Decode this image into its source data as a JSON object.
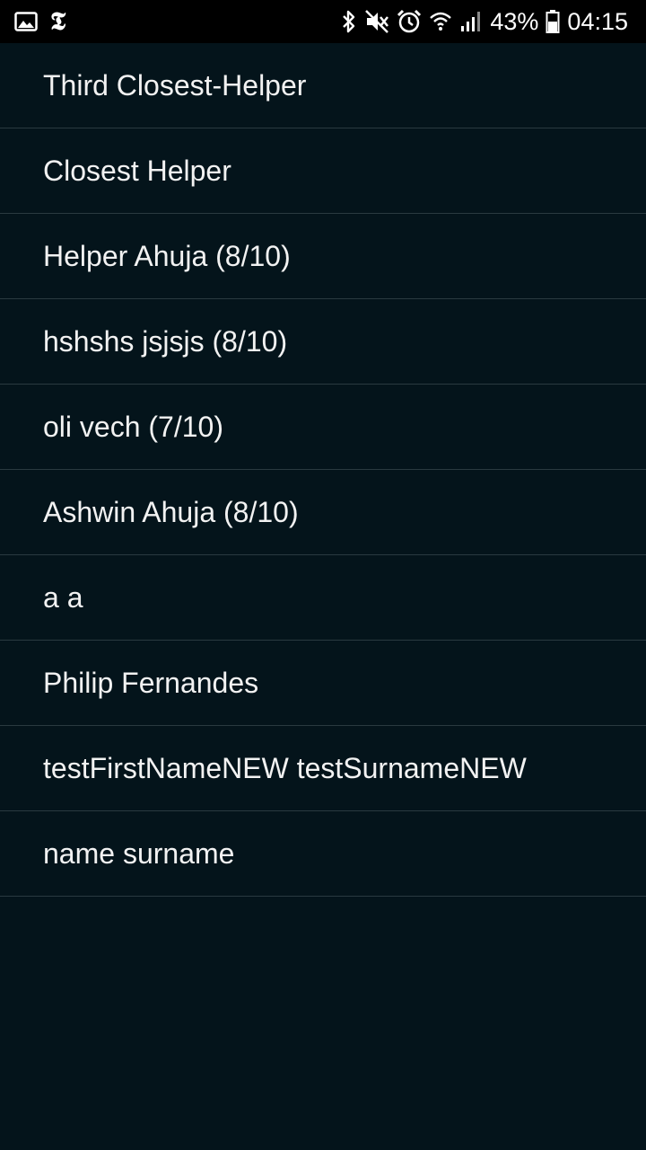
{
  "status_bar": {
    "battery_percent": "43%",
    "time": "04:15",
    "left_icons": [
      "image-icon",
      "nyt-icon"
    ],
    "right_icons": [
      "bluetooth-icon",
      "mute-icon",
      "alarm-icon",
      "wifi-icon",
      "signal-icon",
      "battery-icon"
    ],
    "nyt_glyph": "𝕿"
  },
  "list": {
    "items": [
      {
        "label": "Third Closest-Helper"
      },
      {
        "label": "Closest Helper"
      },
      {
        "label": "Helper Ahuja (8/10)"
      },
      {
        "label": "hshshs jsjsjs (8/10)"
      },
      {
        "label": "oli vech (7/10)"
      },
      {
        "label": "Ashwin Ahuja (8/10)"
      },
      {
        "label": "a a"
      },
      {
        "label": "Philip Fernandes"
      },
      {
        "label": "testFirstNameNEW testSurnameNEW"
      },
      {
        "label": "name surname"
      }
    ]
  },
  "colors": {
    "background": "#04141b",
    "status_bar": "#000000",
    "divider": "#2a3a40",
    "text": "#f2f2f2"
  }
}
